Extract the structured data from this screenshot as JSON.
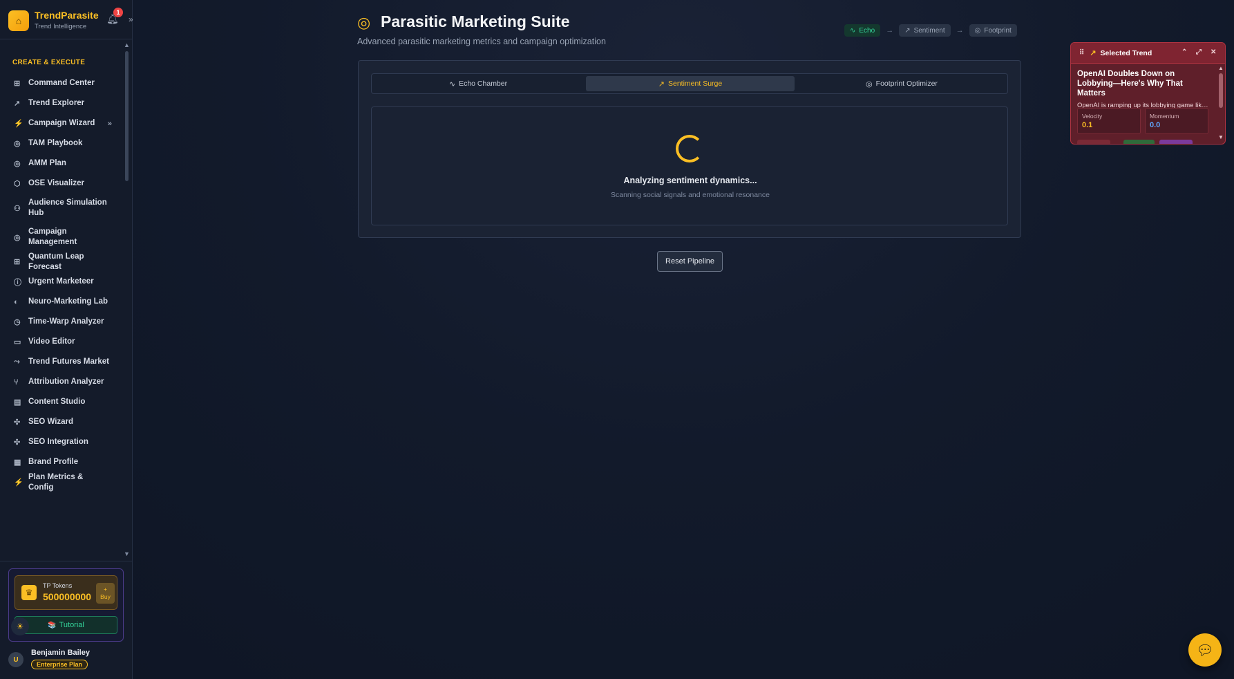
{
  "app": {
    "name": "TrendParasite",
    "tagline": "Trend Intelligence",
    "notification_count": "1"
  },
  "sidebar": {
    "section_title": "CREATE & EXECUTE",
    "items": [
      {
        "label": "Command Center",
        "icon": "⊞"
      },
      {
        "label": "Trend Explorer",
        "icon": "↗"
      },
      {
        "label": "Campaign Wizard",
        "icon": "⚡",
        "chevron": "»"
      },
      {
        "label": "TAM Playbook",
        "icon": "◎"
      },
      {
        "label": "AMM Plan",
        "icon": "◎"
      },
      {
        "label": "OSE Visualizer",
        "icon": "⬡"
      },
      {
        "label": "Audience Simulation Hub",
        "icon": "⚇"
      },
      {
        "label": "Campaign Management",
        "icon": "◎"
      },
      {
        "label": "Quantum Leap Forecast",
        "icon": "⊞"
      },
      {
        "label": "Urgent Marketeer",
        "icon": "ⓘ"
      },
      {
        "label": "Neuro-Marketing Lab",
        "icon": "◐"
      },
      {
        "label": "Time-Warp Analyzer",
        "icon": "◷"
      },
      {
        "label": "Video Editor",
        "icon": "▭"
      },
      {
        "label": "Trend Futures Market",
        "icon": "⤳"
      },
      {
        "label": "Attribution Analyzer",
        "icon": "⑂"
      },
      {
        "label": "Content Studio",
        "icon": "▤"
      },
      {
        "label": "SEO Wizard",
        "icon": "✣"
      },
      {
        "label": "SEO Integration",
        "icon": "✣"
      },
      {
        "label": "Brand Profile",
        "icon": "▦"
      },
      {
        "label": "Plan Metrics & Config",
        "icon": "⚡"
      }
    ]
  },
  "tokens": {
    "label": "TP Tokens",
    "value": "500000000",
    "buy_plus": "+",
    "buy_label": "Buy"
  },
  "tutorial": {
    "icon": "📚",
    "label": "Tutorial"
  },
  "user": {
    "initial": "U",
    "name": "Benjamin Bailey",
    "plan": "Enterprise Plan"
  },
  "page": {
    "title": "Parasitic Marketing Suite",
    "subtitle": "Advanced parasitic marketing metrics and campaign optimization"
  },
  "pipeline": {
    "steps": [
      {
        "label": "Echo",
        "icon": "∿",
        "state": "done"
      },
      {
        "label": "Sentiment",
        "icon": "↗",
        "state": "pending"
      },
      {
        "label": "Footprint",
        "icon": "◎",
        "state": "pending"
      }
    ],
    "arrow": "→"
  },
  "tabs": [
    {
      "label": "Echo Chamber",
      "icon": "∿"
    },
    {
      "label": "Sentiment Surge",
      "icon": "↗"
    },
    {
      "label": "Footprint Optimizer",
      "icon": "◎"
    }
  ],
  "loading": {
    "title": "Analyzing sentiment dynamics...",
    "subtitle": "Scanning social signals and emotional resonance"
  },
  "reset_button": "Reset Pipeline",
  "selected_trend": {
    "header": "Selected Trend",
    "headline": "OpenAI Doubles Down on Lobbying—Here's Why That Matters",
    "description": "OpenAI is ramping up its lobbying game like...",
    "metrics": [
      {
        "label": "Velocity",
        "value": "0.1",
        "color": "#fbbf24"
      },
      {
        "label": "Momentum",
        "value": "0.0",
        "color": "#60a5fa"
      }
    ]
  },
  "colors": {
    "accent": "#fbbf24",
    "success": "#34d399",
    "danger": "#ef4444",
    "background": "#121a2b"
  }
}
